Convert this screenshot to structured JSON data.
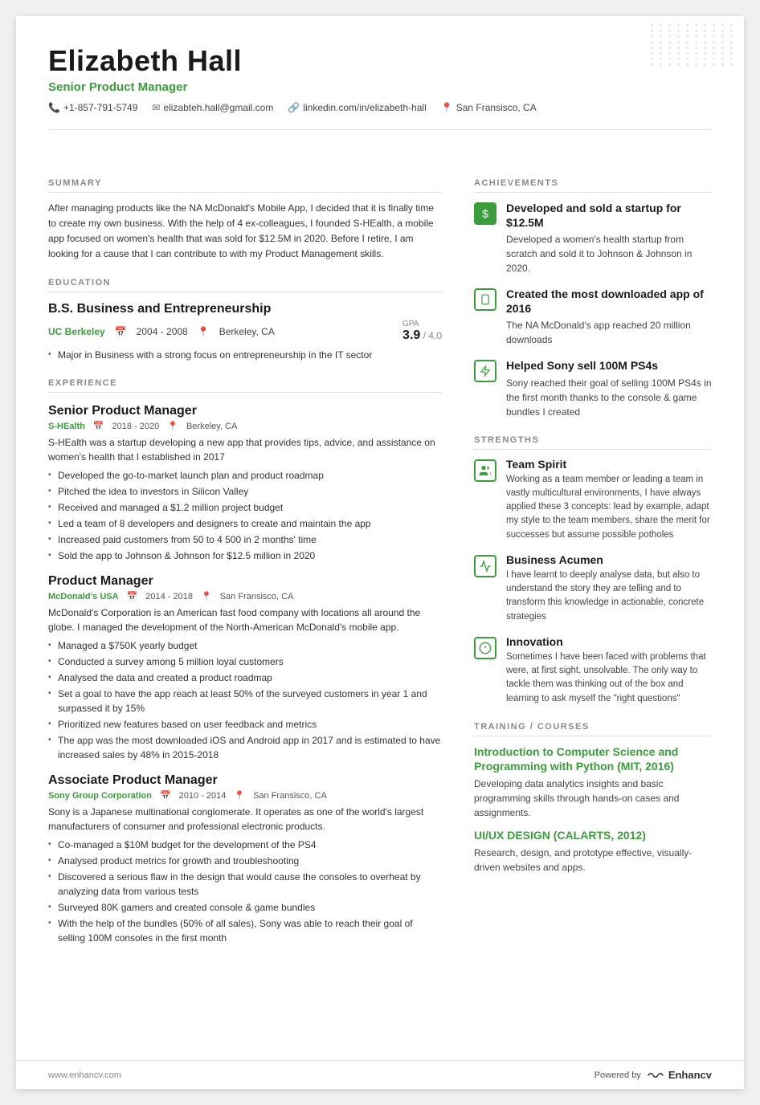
{
  "header": {
    "name": "Elizabeth Hall",
    "title": "Senior Product Manager",
    "phone": "+1-857-791-5749",
    "email": "elizabteh.hall@gmail.com",
    "linkedin": "linkedin.com/in/elizabeth-hall",
    "location": "San Fransisco, CA"
  },
  "summary": {
    "label": "SUMMARY",
    "text": "After managing products like the NA McDonald's Mobile App, I decided that it is finally time to create my own business. With the help of 4 ex-colleagues, I founded S-HEalth, a mobile app focused on women's health that was sold for $12.5M in 2020. Before I retire, I am looking for a cause that I can contribute to with my Product Management skills."
  },
  "education": {
    "label": "EDUCATION",
    "degree": "B.S. Business and Entrepreneurship",
    "school": "UC Berkeley",
    "years": "2004 - 2008",
    "location": "Berkeley, CA",
    "gpa_label": "GPA",
    "gpa_value": "3.9",
    "gpa_max": "/ 4.0",
    "bullets": [
      "Major in Business with a strong focus on entrepreneurship in the IT sector"
    ]
  },
  "experience": {
    "label": "EXPERIENCE",
    "jobs": [
      {
        "title": "Senior Product Manager",
        "company": "S-HEalth",
        "years": "2018 - 2020",
        "location": "Berkeley, CA",
        "description": "S-HEalth was a startup developing a new app that provides tips, advice, and assistance on women's health that I established in 2017",
        "bullets": [
          "Developed the go-to-market launch plan and product roadmap",
          "Pitched the idea to investors in Silicon Valley",
          "Received and managed a $1.2 million project budget",
          "Led a team of 8 developers and designers to create and maintain the app",
          "Increased paid customers from 50 to 4 500 in 2 months' time",
          "Sold the app to Johnson & Johnson for $12.5 million in 2020"
        ]
      },
      {
        "title": "Product Manager",
        "company": "McDonald's USA",
        "years": "2014 - 2018",
        "location": "San Fransisco, CA",
        "description": "McDonald's Corporation is an American fast food company with locations all around the globe. I managed the development of the North-American McDonald's mobile app.",
        "bullets": [
          "Managed a $750K yearly budget",
          "Conducted a survey among 5 million loyal customers",
          "Analysed the data and created a product roadmap",
          "Set a goal to have the app reach at least 50% of the surveyed customers in year 1 and surpassed it by 15%",
          "Prioritized new features based on user feedback and metrics",
          "The app was the most downloaded iOS and Android app in 2017 and is estimated to have increased sales by 48% in 2015-2018"
        ]
      },
      {
        "title": "Associate Product Manager",
        "company": "Sony Group Corporation",
        "years": "2010 - 2014",
        "location": "San Fransisco, CA",
        "description": "Sony is a Japanese multinational conglomerate. It operates as one of the world's largest manufacturers of consumer and professional electronic products.",
        "bullets": [
          "Co-managed a $10M budget for the development of the PS4",
          "Analysed product metrics for growth and troubleshooting",
          "Discovered a serious flaw in the design that would cause the consoles to overheat by analyzing data from various tests",
          "Surveyed 80K gamers and created console & game bundles",
          "With the help of the bundles (50% of all sales), Sony was able to reach their goal of selling 100M consoles in the first month"
        ]
      }
    ]
  },
  "achievements": {
    "label": "ACHIEVEMENTS",
    "items": [
      {
        "icon": "$",
        "icon_type": "green-bg",
        "title": "Developed and sold a startup for $12.5M",
        "description": "Developed a women's health startup from scratch and sold it to Johnson & Johnson in 2020."
      },
      {
        "icon": "📱",
        "icon_type": "outline-green",
        "title": "Created the most downloaded app of 2016",
        "description": "The NA McDonald's app reached 20 million downloads"
      },
      {
        "icon": "🎮",
        "icon_type": "outline-green",
        "title": "Helped Sony sell 100M PS4s",
        "description": "Sony reached their goal of selling 100M PS4s in the first month thanks to the console & game bundles I created"
      }
    ]
  },
  "strengths": {
    "label": "STRENGTHS",
    "items": [
      {
        "icon": "👥",
        "title": "Team Spirit",
        "description": "Working as a team member or leading a team in vastly multicultural environments, I have always applied these 3 concepts: lead by example, adapt my style to the team members, share the merit for successes but assume possible potholes"
      },
      {
        "icon": "📈",
        "title": "Business Acumen",
        "description": "I have learnt to deeply analyse data, but also to understand the story they are telling and to transform this knowledge in actionable, concrete strategies"
      },
      {
        "icon": "💡",
        "title": "Innovation",
        "description": "Sometimes I have been faced with problems that were, at first sight, unsolvable. The only way to tackle them was thinking out of the box and learning to ask myself the \"right questions\""
      }
    ]
  },
  "training": {
    "label": "TRAINING / COURSES",
    "items": [
      {
        "title": "Introduction to Computer Science and Programming with Python (MIT, 2016)",
        "description": "Developing data analytics insights and basic programming skills through hands-on cases and assignments."
      },
      {
        "title": "UI/UX DESIGN (CALARTS, 2012)",
        "description": "Research, design, and prototype effective, visually-driven websites and apps."
      }
    ]
  },
  "footer": {
    "website": "www.enhancv.com",
    "powered_by": "Powered by",
    "brand": "Enhancv"
  }
}
